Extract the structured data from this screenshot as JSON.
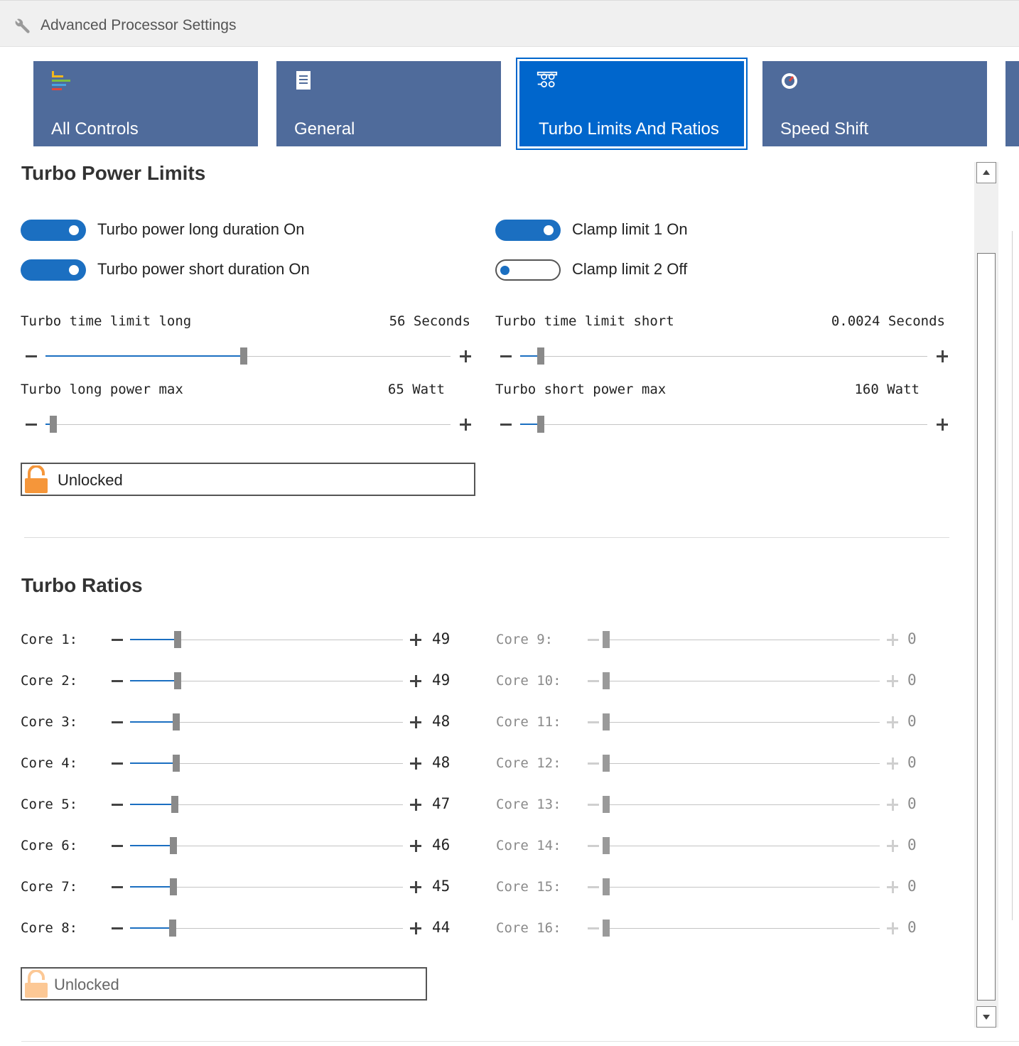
{
  "window": {
    "title": "Advanced Processor Settings",
    "icon": "wrench-icon"
  },
  "tabs": [
    {
      "label": "All Controls",
      "icon": "bars-icon",
      "active": false
    },
    {
      "label": "General",
      "icon": "document-icon",
      "active": false
    },
    {
      "label": "Turbo Limits And Ratios",
      "icon": "sliders-icon",
      "active": true
    },
    {
      "label": "Speed Shift",
      "icon": "speedometer-icon",
      "active": false
    }
  ],
  "power_limits": {
    "heading": "Turbo Power Limits",
    "toggles": [
      {
        "label": "Turbo power long duration On",
        "on": true
      },
      {
        "label": "Turbo power short duration On",
        "on": true
      },
      {
        "label": "Clamp limit 1 On",
        "on": true
      },
      {
        "label": "Clamp limit 2 Off",
        "on": false
      }
    ],
    "sliders": [
      {
        "label": "Turbo time limit long",
        "value": "56 Seconds",
        "position": 0.49
      },
      {
        "label": "Turbo time limit short",
        "value": "0.0024 Seconds",
        "position": 0.05
      },
      {
        "label": "Turbo long power max",
        "value": "65 Watt",
        "position": 0.02
      },
      {
        "label": "Turbo short power max",
        "value": "160 Watt",
        "position": 0.05
      }
    ],
    "lock_label": "Unlocked"
  },
  "turbo_ratios": {
    "heading": "Turbo Ratios",
    "cores": [
      {
        "label": "Core 1:",
        "value": "49",
        "position": 0.175,
        "enabled": true
      },
      {
        "label": "Core 2:",
        "value": "49",
        "position": 0.175,
        "enabled": true
      },
      {
        "label": "Core 3:",
        "value": "48",
        "position": 0.17,
        "enabled": true
      },
      {
        "label": "Core 4:",
        "value": "48",
        "position": 0.17,
        "enabled": true
      },
      {
        "label": "Core 5:",
        "value": "47",
        "position": 0.165,
        "enabled": true
      },
      {
        "label": "Core 6:",
        "value": "46",
        "position": 0.16,
        "enabled": true
      },
      {
        "label": "Core 7:",
        "value": "45",
        "position": 0.16,
        "enabled": true
      },
      {
        "label": "Core 8:",
        "value": "44",
        "position": 0.155,
        "enabled": true
      },
      {
        "label": "Core 9:",
        "value": "0",
        "position": 0.0,
        "enabled": false
      },
      {
        "label": "Core 10:",
        "value": "0",
        "position": 0.0,
        "enabled": false
      },
      {
        "label": "Core 11:",
        "value": "0",
        "position": 0.0,
        "enabled": false
      },
      {
        "label": "Core 12:",
        "value": "0",
        "position": 0.0,
        "enabled": false
      },
      {
        "label": "Core 13:",
        "value": "0",
        "position": 0.0,
        "enabled": false
      },
      {
        "label": "Core 14:",
        "value": "0",
        "position": 0.0,
        "enabled": false
      },
      {
        "label": "Core 15:",
        "value": "0",
        "position": 0.0,
        "enabled": false
      },
      {
        "label": "Core 16:",
        "value": "0",
        "position": 0.0,
        "enabled": false
      }
    ],
    "lock_label": "Unlocked"
  },
  "colors": {
    "tab": "#4f6b9b",
    "tab_active": "#0066cc",
    "accent": "#1b6fc1",
    "lock": "#f5963a"
  }
}
